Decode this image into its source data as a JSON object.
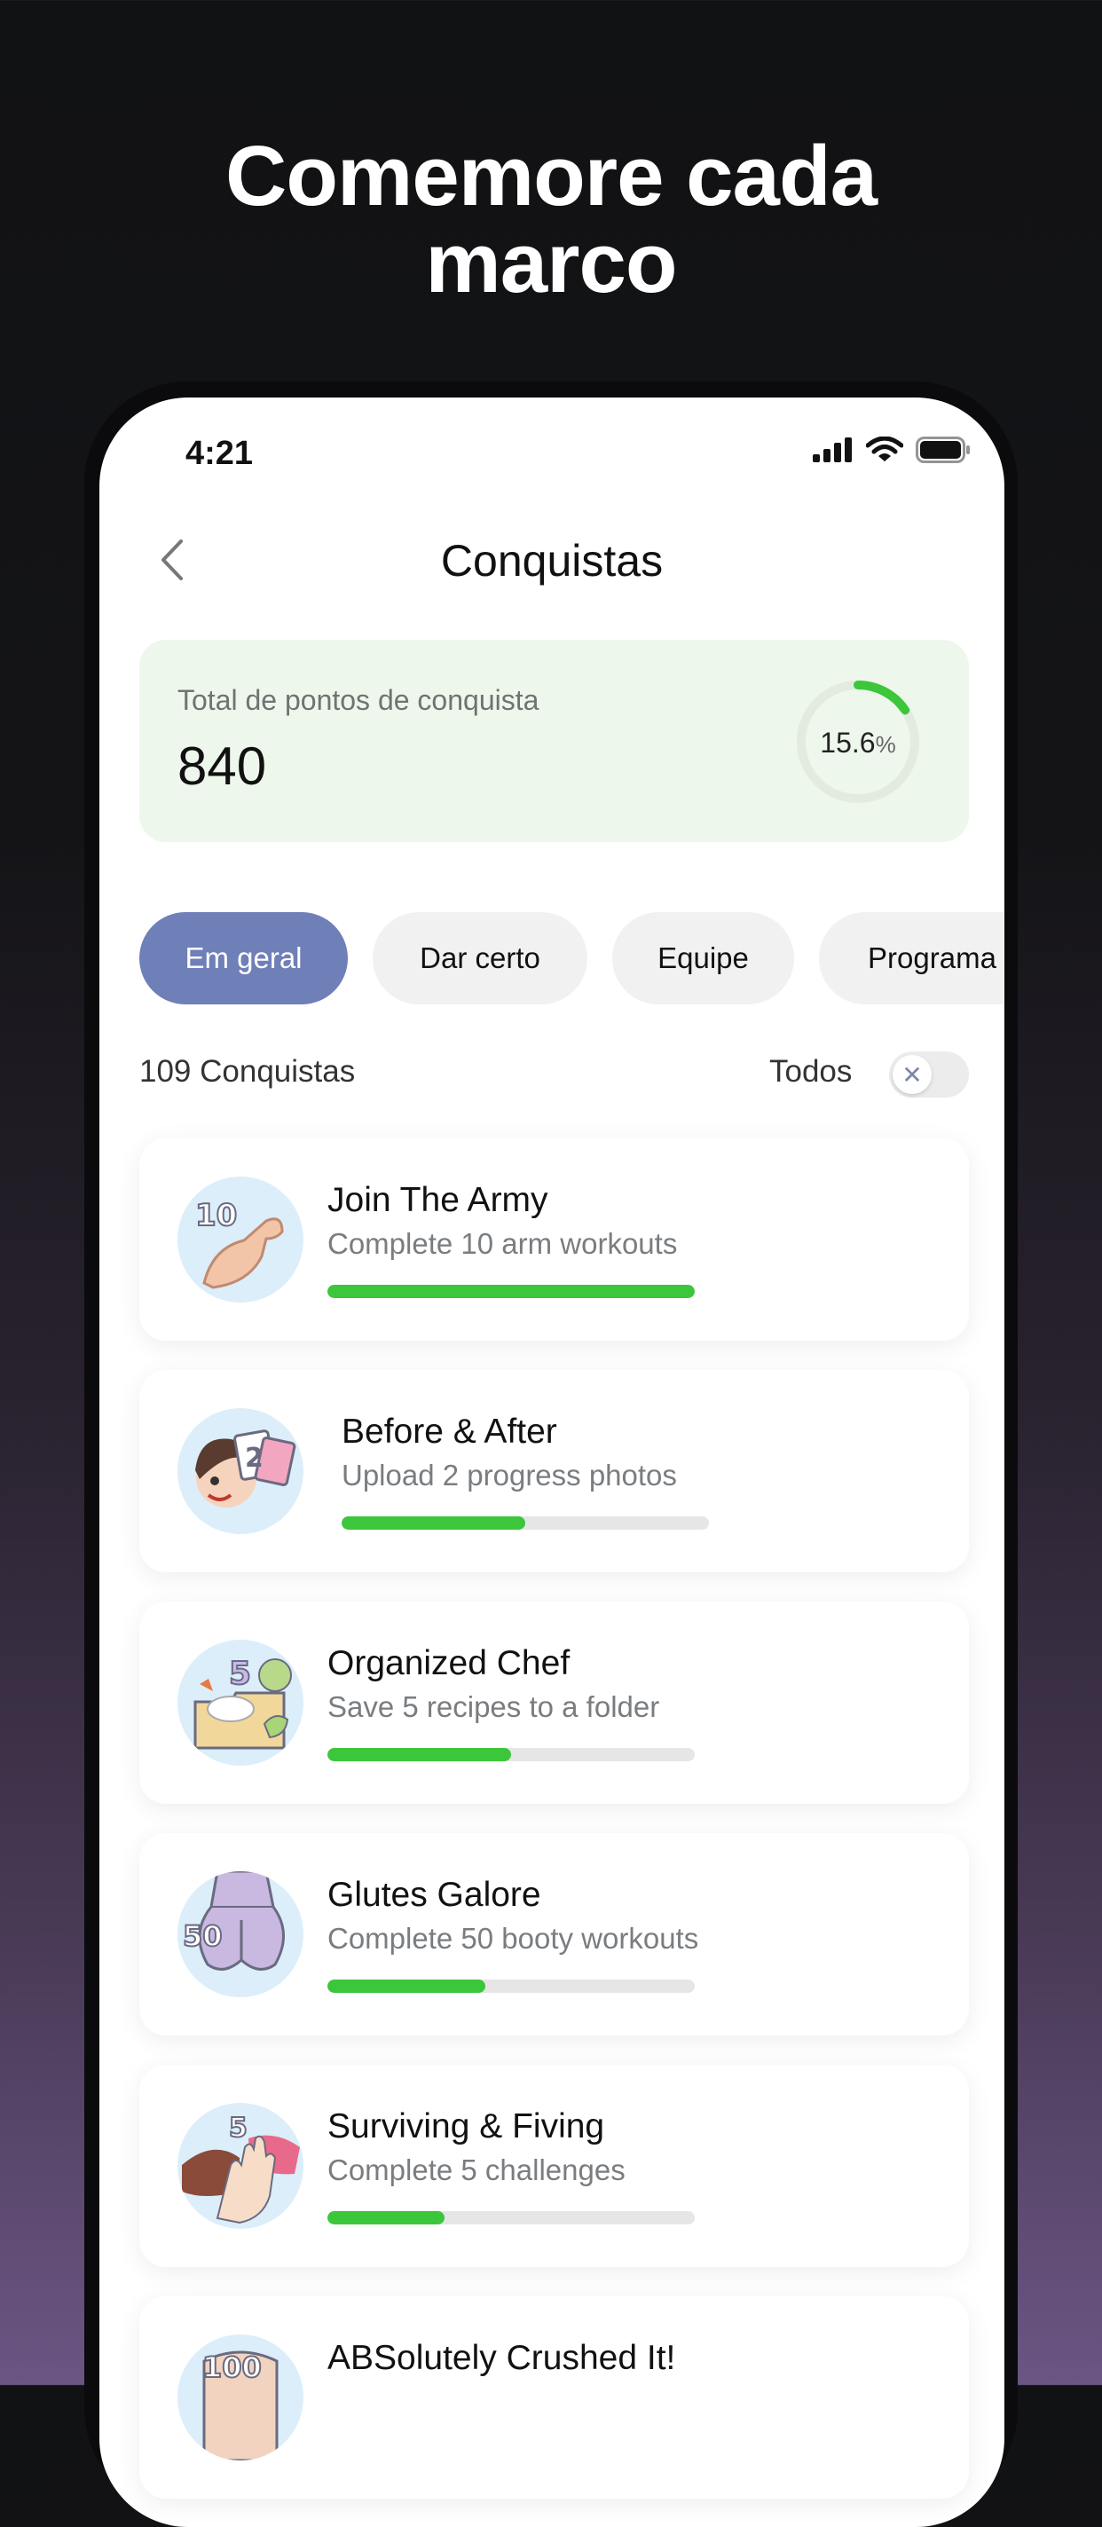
{
  "headline": {
    "line1": "Comemore cada",
    "line2": "marco"
  },
  "status_bar": {
    "time": "4:21",
    "icons": [
      "cellular-signal-icon",
      "wifi-icon",
      "battery-icon"
    ]
  },
  "header": {
    "title": "Conquistas",
    "back_icon": "chevron-left-icon"
  },
  "points": {
    "label": "Total de pontos de conquista",
    "value": "840",
    "percent_value": "15.6",
    "percent_sign": "%",
    "progress_fraction": 0.156
  },
  "filters": [
    {
      "label": "Em geral",
      "active": true
    },
    {
      "label": "Dar certo",
      "active": false
    },
    {
      "label": "Equipe",
      "active": false
    },
    {
      "label": "Programa",
      "active": false
    }
  ],
  "list_header": {
    "count_label": "109 Conquistas",
    "toggle_label": "Todos",
    "toggle_on": false,
    "toggle_icon": "close-icon"
  },
  "achievements": [
    {
      "title": "Join The Army",
      "description": "Complete 10 arm workouts",
      "progress": 1.0,
      "badge_number": "10",
      "badge_icon": "flexed-arm-icon"
    },
    {
      "title": "Before & After",
      "description": "Upload 2 progress photos",
      "progress": 0.5,
      "badge_number": "2",
      "badge_icon": "selfie-photos-icon"
    },
    {
      "title": "Organized Chef",
      "description": "Save 5 recipes to a folder",
      "progress": 0.5,
      "badge_number": "5",
      "badge_icon": "recipe-folder-icon"
    },
    {
      "title": "Glutes Galore",
      "description": "Complete 50 booty workouts",
      "progress": 0.43,
      "badge_number": "50",
      "badge_icon": "glutes-icon"
    },
    {
      "title": "Surviving & Fiving",
      "description": "Complete 5 challenges",
      "progress": 0.32,
      "badge_number": "5",
      "badge_icon": "high-five-icon"
    },
    {
      "title": "ABSolutely Crushed It!",
      "description": "",
      "progress": null,
      "badge_number": "100",
      "badge_icon": "abs-icon"
    }
  ],
  "colors": {
    "accent_chip": "#6f7fb8",
    "progress_green": "#3cc63c",
    "points_card_bg": "#eef7ec"
  }
}
